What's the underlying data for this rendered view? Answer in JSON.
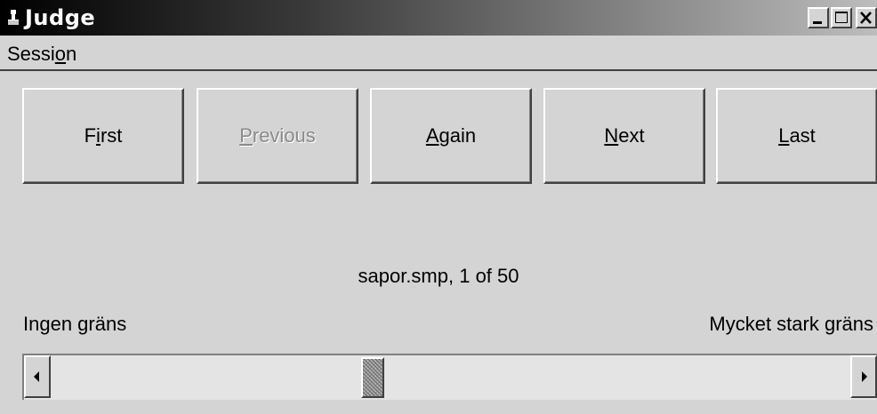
{
  "window": {
    "title": "Judge",
    "icon": "judge-gavel-icon"
  },
  "titlebar_buttons": [
    {
      "name": "minimize",
      "icon": "minimize-icon"
    },
    {
      "name": "maximize",
      "icon": "maximize-icon"
    },
    {
      "name": "close",
      "icon": "close-icon"
    }
  ],
  "menu": {
    "session": {
      "pre": "Sessi",
      "mnemonic": "o",
      "post": "n"
    }
  },
  "buttons": {
    "first": {
      "pre": "F",
      "mnemonic": "i",
      "post": "rst",
      "enabled": true
    },
    "previous": {
      "pre": "",
      "mnemonic": "P",
      "post": "revious",
      "enabled": false
    },
    "again": {
      "pre": "",
      "mnemonic": "A",
      "post": "gain",
      "enabled": true
    },
    "next": {
      "pre": "",
      "mnemonic": "N",
      "post": "ext",
      "enabled": true
    },
    "last": {
      "pre": "",
      "mnemonic": "L",
      "post": "ast",
      "enabled": true
    }
  },
  "status": "sapor.smp, 1 of 50",
  "scale": {
    "left_label": "Ingen gräns",
    "right_label": "Mycket stark gräns",
    "value_fraction": 0.4,
    "left_arrow_icon": "arrow-left-icon",
    "right_arrow_icon": "arrow-right-icon"
  },
  "colors": {
    "face": "#d4d4d4",
    "title_start": "#000000",
    "title_end": "#bdbdbd",
    "disabled_text": "#8a8a8a"
  }
}
